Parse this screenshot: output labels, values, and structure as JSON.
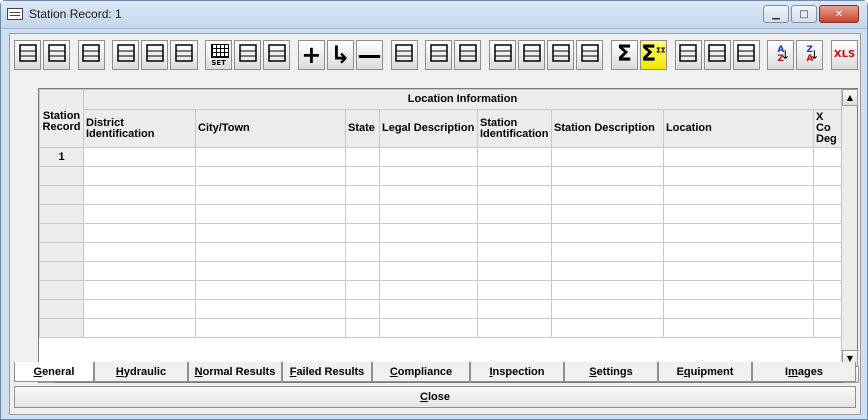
{
  "window": {
    "title": "Station Record: 1"
  },
  "toolbar": {
    "buttons": [
      {
        "name": "first-record-icon"
      },
      {
        "name": "last-record-icon"
      },
      {
        "name": "find-icon"
      },
      {
        "name": "pointer-hand-icon"
      },
      {
        "name": "clipboard-icon"
      },
      {
        "name": "3d-box-icon"
      },
      {
        "name": "grid-set-icon",
        "label": "SET"
      },
      {
        "name": "grid-width-icon"
      },
      {
        "name": "print-icon"
      },
      {
        "name": "add-icon",
        "glyph": "+"
      },
      {
        "name": "insert-arrow-icon",
        "glyph": "↳"
      },
      {
        "name": "delete-icon",
        "glyph": "—"
      },
      {
        "name": "face-icon"
      },
      {
        "name": "list-icon"
      },
      {
        "name": "list-2-icon"
      },
      {
        "name": "help-icon"
      },
      {
        "name": "edit-document-icon"
      },
      {
        "name": "save-print-icon"
      },
      {
        "name": "hand-stop-icon"
      },
      {
        "name": "sum-icon",
        "glyph": "Σ"
      },
      {
        "name": "sum-all-icon",
        "glyph": "Σ",
        "sup": "ΣΣ"
      },
      {
        "name": "window-icon"
      },
      {
        "name": "columns-icon"
      },
      {
        "name": "grid-icon"
      },
      {
        "name": "sort-ascending-icon",
        "top": "A",
        "bottom": "Z"
      },
      {
        "name": "sort-descending-icon",
        "top": "Z",
        "bottom": "A"
      },
      {
        "name": "export-xls-icon",
        "label": "XLS"
      }
    ]
  },
  "grid": {
    "group_header": "Location Information",
    "row_header": "Station Record",
    "columns": [
      "District Identification",
      "City/Town",
      "State",
      "Legal Description",
      "Station Identification",
      "Station Description",
      "Location",
      "X Co Deg"
    ],
    "rows": [
      {
        "num": "1"
      },
      {
        "num": ""
      },
      {
        "num": ""
      },
      {
        "num": ""
      },
      {
        "num": ""
      },
      {
        "num": ""
      },
      {
        "num": ""
      },
      {
        "num": ""
      },
      {
        "num": ""
      },
      {
        "num": ""
      }
    ]
  },
  "tabs": [
    {
      "label": "General",
      "underline": "G",
      "active": true
    },
    {
      "label": "Hydraulic",
      "underline": "H"
    },
    {
      "label": "Normal Results",
      "underline": "N"
    },
    {
      "label": "Failed Results",
      "underline": "F"
    },
    {
      "label": "Compliance",
      "underline": "C"
    },
    {
      "label": "Inspection",
      "underline": "I"
    },
    {
      "label": "Settings",
      "underline": "S"
    },
    {
      "label": "Equipment",
      "underline": "q"
    },
    {
      "label": "Images",
      "underline": "m"
    }
  ],
  "footer": {
    "close_label": "Close"
  },
  "colors": {
    "titlebar": "#c4d7ec",
    "close_button": "#c8452d",
    "sum_highlight": "#f2e600"
  }
}
